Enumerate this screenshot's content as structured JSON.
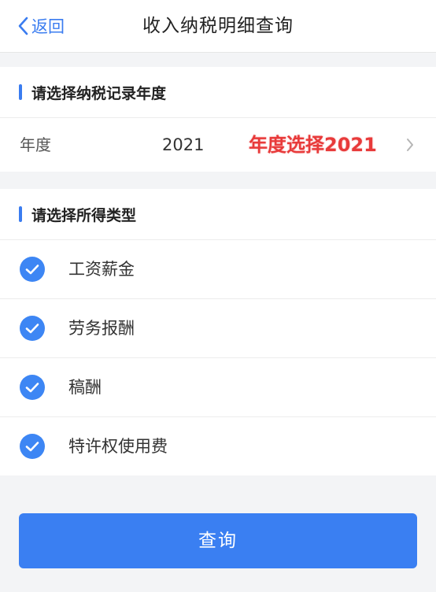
{
  "nav": {
    "back_label": "返回",
    "title": "收入纳税明细查询"
  },
  "year_section": {
    "title": "请选择纳税记录年度",
    "row_label": "年度",
    "row_value": "2021",
    "annotation": "年度选择2021"
  },
  "type_section": {
    "title": "请选择所得类型",
    "items": [
      {
        "label": "工资薪金",
        "checked": true
      },
      {
        "label": "劳务报酬",
        "checked": true
      },
      {
        "label": "稿酬",
        "checked": true
      },
      {
        "label": "特许权使用费",
        "checked": true
      }
    ]
  },
  "query_button": {
    "label": "查询"
  },
  "colors": {
    "accent": "#3a7cf0",
    "annotation": "#e83a3a",
    "background": "#f3f4f6"
  },
  "icons": {
    "back": "chevron-left-icon",
    "row_arrow": "chevron-right-icon",
    "checked": "check-circle-icon"
  }
}
